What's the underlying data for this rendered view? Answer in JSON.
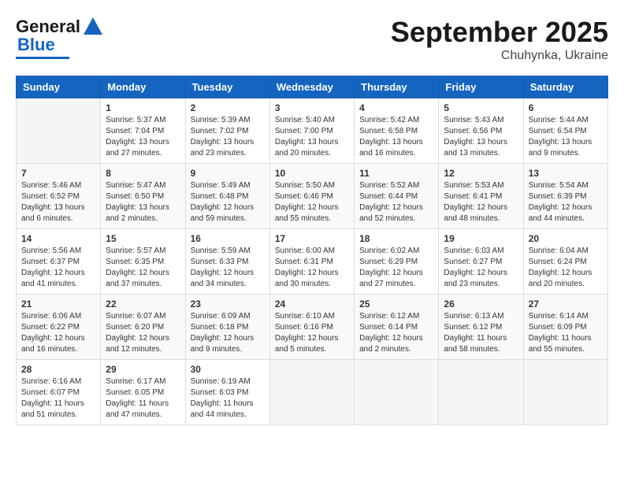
{
  "header": {
    "logo_line1": "General",
    "logo_line2": "Blue",
    "title": "September 2025",
    "subtitle": "Chuhynka, Ukraine"
  },
  "days_of_week": [
    "Sunday",
    "Monday",
    "Tuesday",
    "Wednesday",
    "Thursday",
    "Friday",
    "Saturday"
  ],
  "weeks": [
    [
      {
        "day": "",
        "info": ""
      },
      {
        "day": "1",
        "info": "Sunrise: 5:37 AM\nSunset: 7:04 PM\nDaylight: 13 hours\nand 27 minutes."
      },
      {
        "day": "2",
        "info": "Sunrise: 5:39 AM\nSunset: 7:02 PM\nDaylight: 13 hours\nand 23 minutes."
      },
      {
        "day": "3",
        "info": "Sunrise: 5:40 AM\nSunset: 7:00 PM\nDaylight: 13 hours\nand 20 minutes."
      },
      {
        "day": "4",
        "info": "Sunrise: 5:42 AM\nSunset: 6:58 PM\nDaylight: 13 hours\nand 16 minutes."
      },
      {
        "day": "5",
        "info": "Sunrise: 5:43 AM\nSunset: 6:56 PM\nDaylight: 13 hours\nand 13 minutes."
      },
      {
        "day": "6",
        "info": "Sunrise: 5:44 AM\nSunset: 6:54 PM\nDaylight: 13 hours\nand 9 minutes."
      }
    ],
    [
      {
        "day": "7",
        "info": "Sunrise: 5:46 AM\nSunset: 6:52 PM\nDaylight: 13 hours\nand 6 minutes."
      },
      {
        "day": "8",
        "info": "Sunrise: 5:47 AM\nSunset: 6:50 PM\nDaylight: 13 hours\nand 2 minutes."
      },
      {
        "day": "9",
        "info": "Sunrise: 5:49 AM\nSunset: 6:48 PM\nDaylight: 12 hours\nand 59 minutes."
      },
      {
        "day": "10",
        "info": "Sunrise: 5:50 AM\nSunset: 6:46 PM\nDaylight: 12 hours\nand 55 minutes."
      },
      {
        "day": "11",
        "info": "Sunrise: 5:52 AM\nSunset: 6:44 PM\nDaylight: 12 hours\nand 52 minutes."
      },
      {
        "day": "12",
        "info": "Sunrise: 5:53 AM\nSunset: 6:41 PM\nDaylight: 12 hours\nand 48 minutes."
      },
      {
        "day": "13",
        "info": "Sunrise: 5:54 AM\nSunset: 6:39 PM\nDaylight: 12 hours\nand 44 minutes."
      }
    ],
    [
      {
        "day": "14",
        "info": "Sunrise: 5:56 AM\nSunset: 6:37 PM\nDaylight: 12 hours\nand 41 minutes."
      },
      {
        "day": "15",
        "info": "Sunrise: 5:57 AM\nSunset: 6:35 PM\nDaylight: 12 hours\nand 37 minutes."
      },
      {
        "day": "16",
        "info": "Sunrise: 5:59 AM\nSunset: 6:33 PM\nDaylight: 12 hours\nand 34 minutes."
      },
      {
        "day": "17",
        "info": "Sunrise: 6:00 AM\nSunset: 6:31 PM\nDaylight: 12 hours\nand 30 minutes."
      },
      {
        "day": "18",
        "info": "Sunrise: 6:02 AM\nSunset: 6:29 PM\nDaylight: 12 hours\nand 27 minutes."
      },
      {
        "day": "19",
        "info": "Sunrise: 6:03 AM\nSunset: 6:27 PM\nDaylight: 12 hours\nand 23 minutes."
      },
      {
        "day": "20",
        "info": "Sunrise: 6:04 AM\nSunset: 6:24 PM\nDaylight: 12 hours\nand 20 minutes."
      }
    ],
    [
      {
        "day": "21",
        "info": "Sunrise: 6:06 AM\nSunset: 6:22 PM\nDaylight: 12 hours\nand 16 minutes."
      },
      {
        "day": "22",
        "info": "Sunrise: 6:07 AM\nSunset: 6:20 PM\nDaylight: 12 hours\nand 12 minutes."
      },
      {
        "day": "23",
        "info": "Sunrise: 6:09 AM\nSunset: 6:18 PM\nDaylight: 12 hours\nand 9 minutes."
      },
      {
        "day": "24",
        "info": "Sunrise: 6:10 AM\nSunset: 6:16 PM\nDaylight: 12 hours\nand 5 minutes."
      },
      {
        "day": "25",
        "info": "Sunrise: 6:12 AM\nSunset: 6:14 PM\nDaylight: 12 hours\nand 2 minutes."
      },
      {
        "day": "26",
        "info": "Sunrise: 6:13 AM\nSunset: 6:12 PM\nDaylight: 11 hours\nand 58 minutes."
      },
      {
        "day": "27",
        "info": "Sunrise: 6:14 AM\nSunset: 6:09 PM\nDaylight: 11 hours\nand 55 minutes."
      }
    ],
    [
      {
        "day": "28",
        "info": "Sunrise: 6:16 AM\nSunset: 6:07 PM\nDaylight: 11 hours\nand 51 minutes."
      },
      {
        "day": "29",
        "info": "Sunrise: 6:17 AM\nSunset: 6:05 PM\nDaylight: 11 hours\nand 47 minutes."
      },
      {
        "day": "30",
        "info": "Sunrise: 6:19 AM\nSunset: 6:03 PM\nDaylight: 11 hours\nand 44 minutes."
      },
      {
        "day": "",
        "info": ""
      },
      {
        "day": "",
        "info": ""
      },
      {
        "day": "",
        "info": ""
      },
      {
        "day": "",
        "info": ""
      }
    ]
  ]
}
